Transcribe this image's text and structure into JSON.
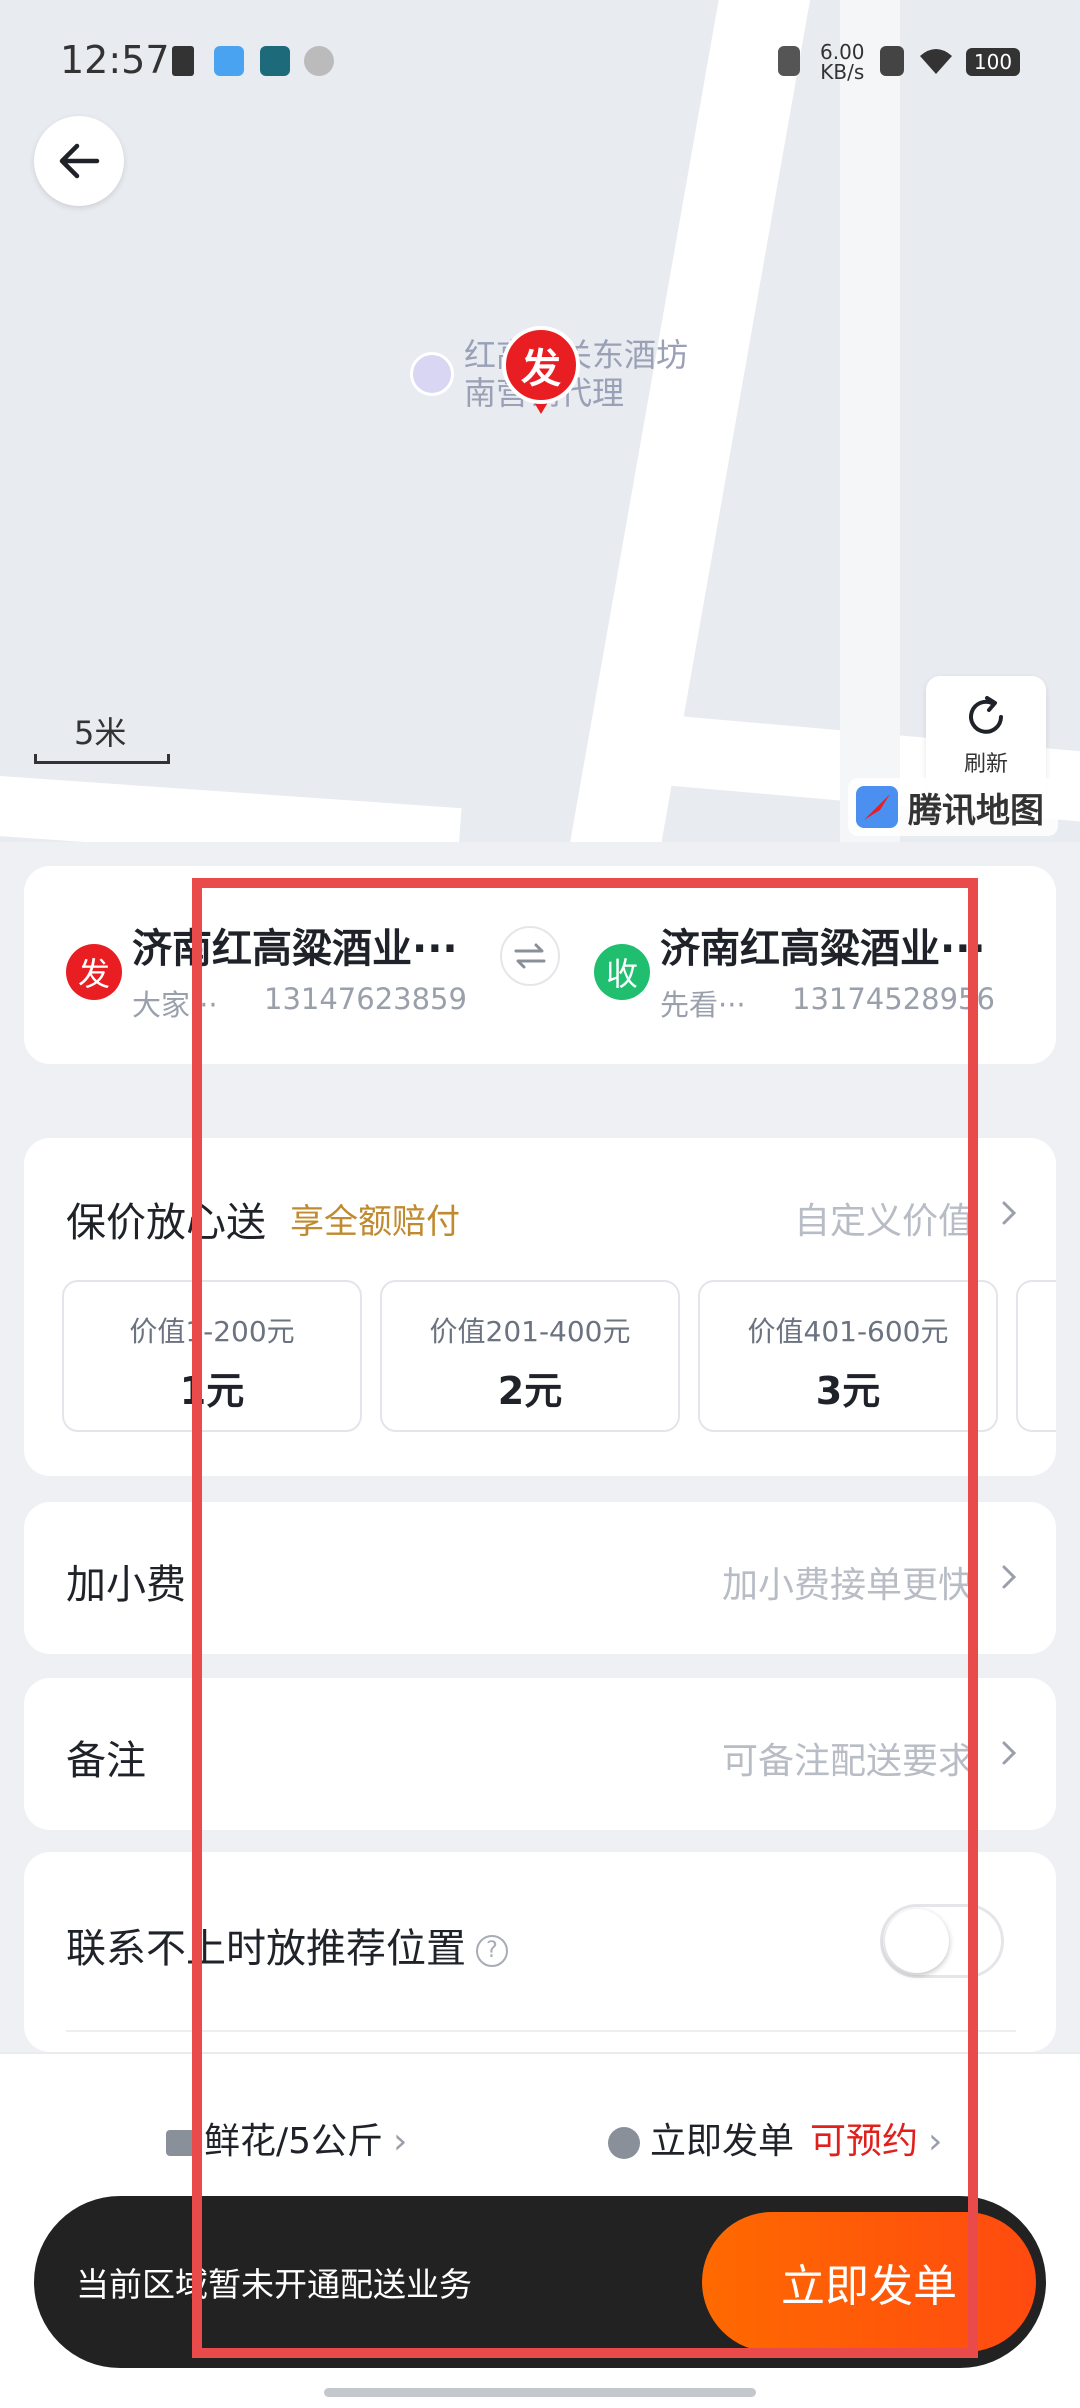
{
  "status": {
    "time": "12:57",
    "net_speed_value": "6.00",
    "net_speed_unit": "KB/s",
    "battery": "100"
  },
  "map": {
    "poi_line1": "红高粱关东酒坊",
    "poi_line2": "南营销代理",
    "pin_label": "发",
    "scale_label": "5米",
    "refresh_label": "刷新",
    "brand": "腾讯地图"
  },
  "address": {
    "sender": {
      "badge": "发",
      "name": "济南红高粱酒业···",
      "contact": "大家···",
      "phone": "13147623859"
    },
    "receiver": {
      "badge": "收",
      "name": "济南红高粱酒业···",
      "contact": "先看···",
      "phone": "13174528956"
    }
  },
  "insurance": {
    "title": "保价放心送",
    "tag": "享全额赔付",
    "hint": "自定义价值",
    "tiers": [
      {
        "label": "价值1-200元",
        "price": "1元"
      },
      {
        "label": "价值201-400元",
        "price": "2元"
      },
      {
        "label": "价值401-600元",
        "price": "3元"
      }
    ]
  },
  "tip": {
    "title": "加小费",
    "hint": "加小费接单更快"
  },
  "note": {
    "title": "备注",
    "hint": "可备注配送要求"
  },
  "contact": {
    "title": "联系不上时放推荐位置",
    "help": "?"
  },
  "bottom": {
    "goods": "鲜花/5公斤",
    "send_now": "立即发单",
    "reserve": "可预约",
    "status_text": "当前区域暂未开通配送业务",
    "submit": "立即发单"
  },
  "colors": {
    "sender": "#e91e22",
    "receiver": "#1fbf6f",
    "accent": "#ff5a0a",
    "tag": "#c08a2e",
    "reserve": "#e0201d"
  }
}
